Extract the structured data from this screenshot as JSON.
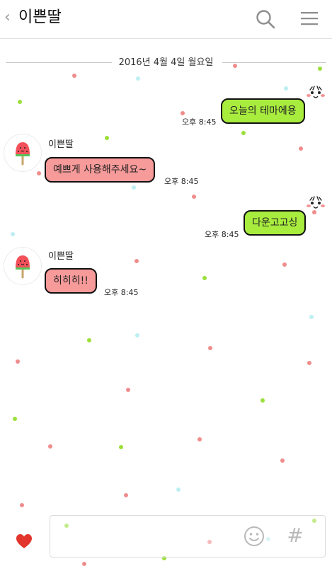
{
  "header": {
    "back_label": "‹",
    "title": "이쁜딸",
    "search_icon": "search-icon",
    "menu_icon": "hamburger-menu-icon"
  },
  "chat": {
    "date": "2016년 4월 4일 월요일",
    "messages": [
      {
        "sender": "",
        "text": "오늘의 테마에용",
        "time": "오후 8:45",
        "mine": true
      },
      {
        "sender": "이쁜딸",
        "text": "예쁘게 사용해주세요~",
        "time": "오후 8:45",
        "mine": false
      },
      {
        "sender": "",
        "text": "다운고고싱",
        "time": "오후 8:45",
        "mine": true
      },
      {
        "sender": "이쁜딸",
        "text": "히히히!!",
        "time": "오후 8:45",
        "mine": false
      }
    ]
  },
  "input": {
    "heart_icon": "heart-icon",
    "emoji_icon": "smiley-icon",
    "hash_label": "#"
  },
  "colors": {
    "my_bubble": "#a8ec3e",
    "their_bubble": "#f79a9a",
    "dot_green": "#9bdf3a",
    "dot_pink": "#f08c8c",
    "dot_cyan": "#bdeef2",
    "heart": "#e2352c"
  }
}
